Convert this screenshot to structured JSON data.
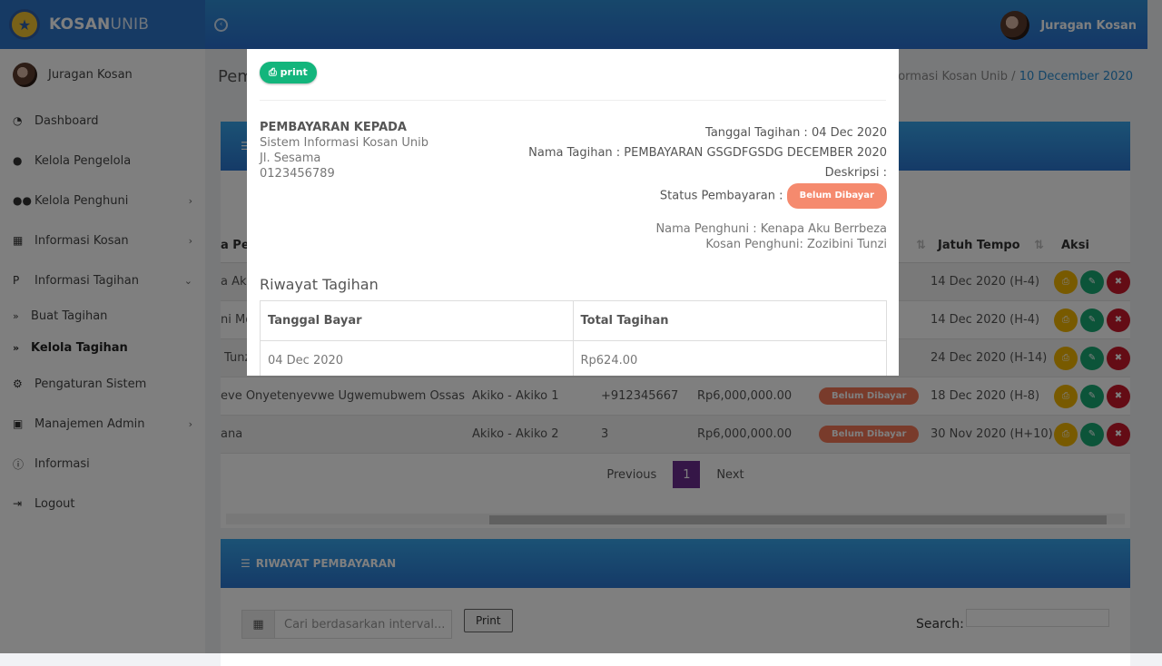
{
  "app": {
    "brand_bold": "KOSAN",
    "brand_light": "UNIB",
    "user_name": "Juragan Kosan"
  },
  "sidebar": {
    "user_name": "Juragan Kosan",
    "items": [
      {
        "label": "Dashboard",
        "icon": "dashboard-icon"
      },
      {
        "label": "Kelola Pengelola",
        "icon": "user-icon"
      },
      {
        "label": "Kelola Penghuni",
        "icon": "users-icon"
      },
      {
        "label": "Informasi Kosan",
        "icon": "bank-icon"
      },
      {
        "label": "Informasi Tagihan",
        "icon": "paypal-icon"
      },
      {
        "label": "Buat Tagihan",
        "icon": "double-chevron-icon"
      },
      {
        "label": "Kelola Tagihan",
        "icon": "double-chevron-icon"
      },
      {
        "label": "Pengaturan Sistem",
        "icon": "cogs-icon"
      },
      {
        "label": "Manajemen Admin",
        "icon": "cubes-icon"
      },
      {
        "label": "Informasi",
        "icon": "info-icon"
      },
      {
        "label": "Logout",
        "icon": "sign-out-icon"
      }
    ]
  },
  "page": {
    "title": "Pem",
    "breadcrumb_prev": "formasi Kosan Unib",
    "breadcrumb_sep": "/",
    "breadcrumb_current": "10 December 2020"
  },
  "table": {
    "headers": {
      "col1": "a Pen",
      "jatuh_tempo": "Jatuh Tempo",
      "aksi": "Aksi"
    },
    "rows": [
      {
        "c1": "a Aku",
        "c2": "",
        "c3": "",
        "c4": "",
        "status": "",
        "due": "14 Dec 2020 (H-4)"
      },
      {
        "c1": "ni Mo",
        "c2": "",
        "c3": "",
        "c4": "",
        "status": "",
        "due": "14 Dec 2020 (H-4)"
      },
      {
        "c1": "Tunz",
        "c2": "",
        "c3": "",
        "c4": "",
        "status": "",
        "due": "24 Dec 2020 (H-14)"
      },
      {
        "c1": "eve Onyetenyevwe Ugwemubwem Ossas",
        "c2": "Akiko - Akiko 1",
        "c3": "+912345667",
        "c4": "Rp6,000,000.00",
        "status": "Belum Dibayar",
        "due": "18 Dec 2020 (H-8)"
      },
      {
        "c1": "ana",
        "c2": "Akiko - Akiko 2",
        "c3": "3",
        "c4": "Rp6,000,000.00",
        "status": "Belum Dibayar",
        "due": "30 Nov 2020 (H+10)"
      }
    ],
    "pager": {
      "prev": "Previous",
      "page": "1",
      "next": "Next"
    }
  },
  "riwayat": {
    "title": "RIWAYAT PEMBAYARAN",
    "date_placeholder": "Cari berdasarkan interval...",
    "print": "Print",
    "search_label": "Search:"
  },
  "modal": {
    "print_label": "print",
    "payto_title": "PEMBAYARAN KEPADA",
    "payto_name": "Sistem Informasi Kosan Unib",
    "payto_address": "Jl. Sesama",
    "payto_phone": "0123456789",
    "tanggal_tagihan": "Tanggal Tagihan : 04 Dec 2020",
    "nama_tagihan": "Nama Tagihan : PEMBAYARAN GSGDFGSDG DECEMBER 2020",
    "deskripsi": "Deskripsi :",
    "status_label": "Status Pembayaran :",
    "status_value": "Belum Dibayar",
    "nama_penghuni": "Nama Penghuni : Kenapa Aku Berrbeza",
    "kosan_penghuni": "Kosan Penghuni: Zozibini Tunzi",
    "riwayat_title": "Riwayat Tagihan",
    "col_tanggal": "Tanggal Bayar",
    "col_total": "Total Tagihan",
    "row_tanggal": "04 Dec 2020",
    "row_total": "Rp624.00"
  },
  "colors": {
    "header": "#2a75cf",
    "badge": "#f37757",
    "print_button": "#13b57c",
    "pager_active": "#6a2c8e"
  }
}
